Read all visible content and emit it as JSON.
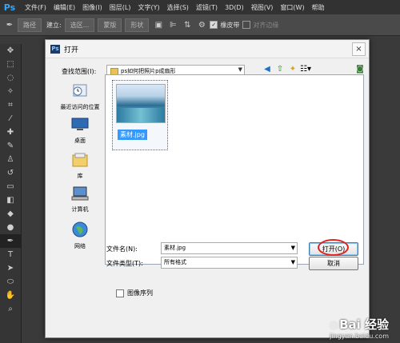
{
  "app": {
    "logo": "Ps",
    "menu": [
      "文件(F)",
      "编辑(E)",
      "图像(I)",
      "图层(L)",
      "文字(Y)",
      "选择(S)",
      "滤镜(T)",
      "3D(D)",
      "视图(V)",
      "窗口(W)",
      "帮助"
    ]
  },
  "options_bar": {
    "mode": "路径",
    "build_label": "建立:",
    "selection": "选区...",
    "mask": "蒙版",
    "shape": "形状",
    "rubber_band": "橡皮带",
    "align_edges": "对齐边缘"
  },
  "dialog": {
    "title": "打开",
    "close": "×",
    "look_in_label": "查找范围(I):",
    "look_in_value": "ps如何把照片p成扇形",
    "places": [
      "最近访问的位置",
      "桌面",
      "库",
      "计算机",
      "网络"
    ],
    "files": [
      {
        "name": "素材.jpg"
      }
    ],
    "file_name_label": "文件名(N):",
    "file_name_value": "素材.jpg",
    "file_type_label": "文件类型(T):",
    "file_type_value": "所有格式",
    "open_button": "打开(O)",
    "cancel_button": "取消",
    "image_sequence": "图像序列"
  },
  "watermark": {
    "main": "Bai 经验",
    "sub": "jingyan.baidu.com"
  }
}
